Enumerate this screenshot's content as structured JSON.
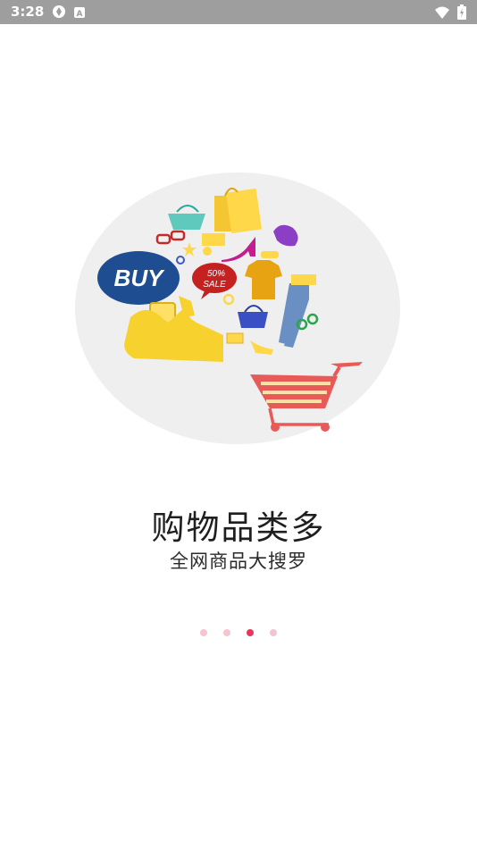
{
  "status_bar": {
    "time": "3:28",
    "icons_left": [
      "sync-icon",
      "notification-a-icon"
    ],
    "icons_right": [
      "wifi-icon",
      "battery-icon"
    ]
  },
  "onboarding": {
    "title": "购物品类多",
    "subtitle": "全网商品大搜罗",
    "illustration": {
      "buy_bubble": "BUY",
      "sale_tag_line1": "50%",
      "sale_tag_line2": "SALE"
    },
    "page_indicator": {
      "total": 4,
      "active_index": 2
    }
  },
  "colors": {
    "accent": "#e8365a",
    "dot_inactive": "#f5c4cf",
    "status_bar": "#9e9e9e",
    "cart": "#e85a57"
  }
}
